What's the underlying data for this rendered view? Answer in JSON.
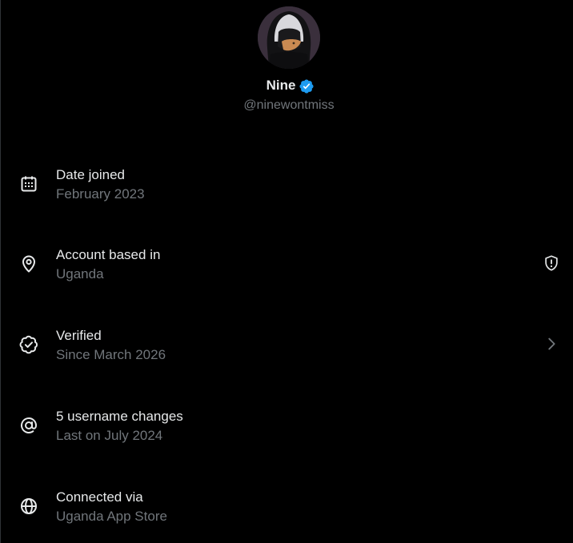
{
  "profile": {
    "display_name": "Nine",
    "handle": "@ninewontmiss",
    "verified_badge_icon": "verified-badge-icon",
    "badge_color": "#1d9bf0"
  },
  "colors": {
    "background": "#000000",
    "primary_text": "#e7e9ea",
    "secondary_text": "#71767b"
  },
  "rows": [
    {
      "icon": "calendar-icon",
      "title": "Date joined",
      "subtitle": "February 2023"
    },
    {
      "icon": "location-pin-icon",
      "title": "Account based in",
      "subtitle": "Uganda",
      "trailing_icon": "shield-alert-icon"
    },
    {
      "icon": "verified-check-icon",
      "title": "Verified",
      "subtitle": "Since March 2026",
      "trailing_icon": "chevron-right-icon"
    },
    {
      "icon": "at-sign-icon",
      "title": "5 username changes",
      "subtitle": "Last on July 2024"
    },
    {
      "icon": "globe-icon",
      "title": "Connected via",
      "subtitle": "Uganda App Store"
    }
  ]
}
